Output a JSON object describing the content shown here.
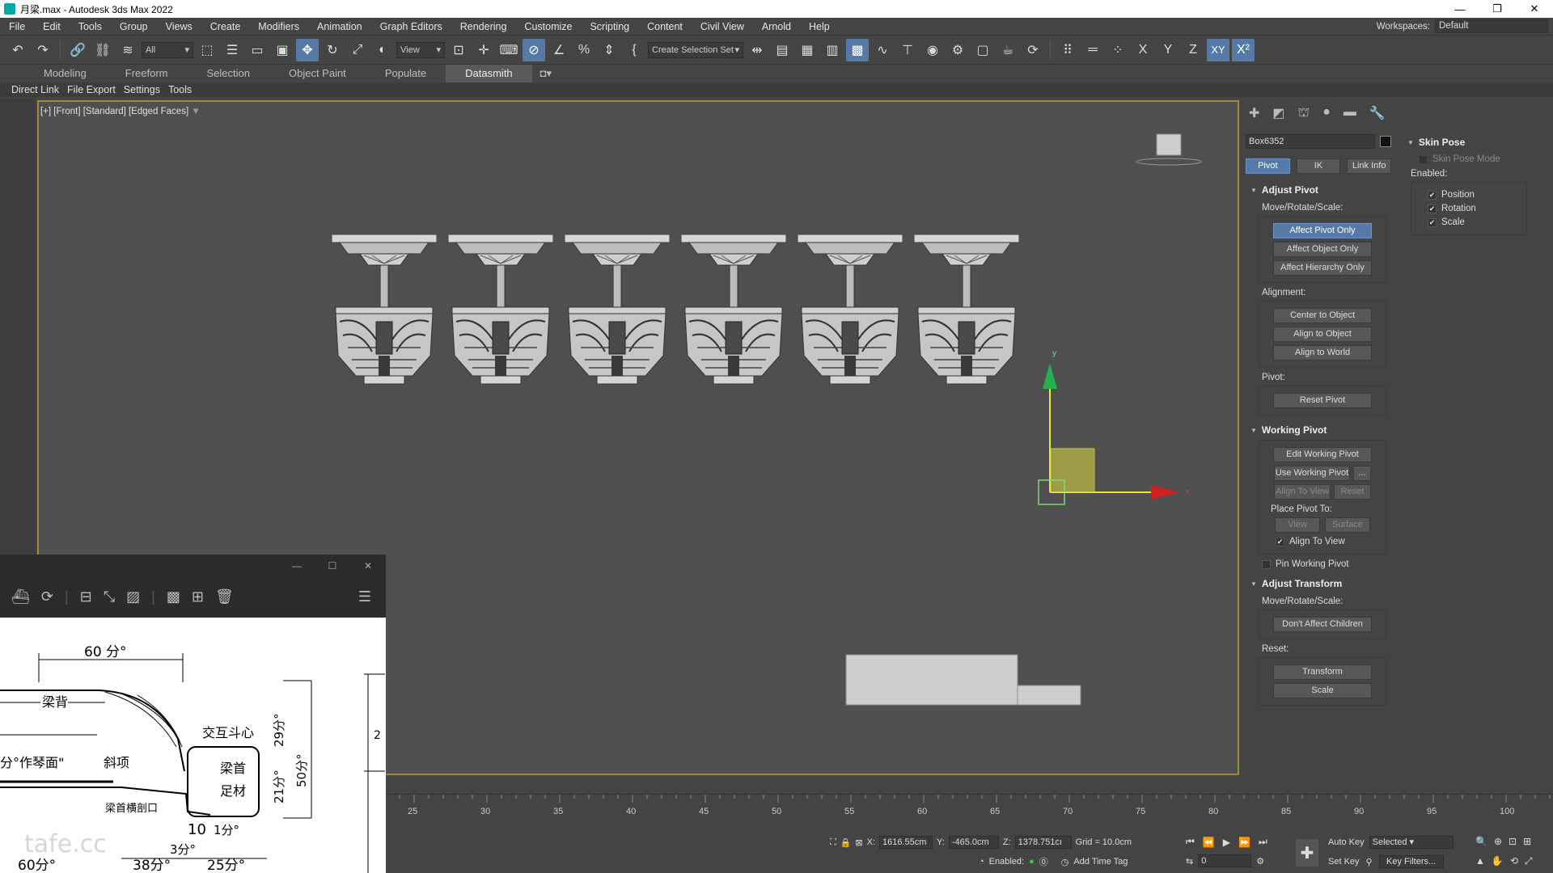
{
  "window": {
    "title": "月梁.max - Autodesk 3ds Max 2022"
  },
  "menu": [
    "File",
    "Edit",
    "Tools",
    "Group",
    "Views",
    "Create",
    "Modifiers",
    "Animation",
    "Graph Editors",
    "Rendering",
    "Customize",
    "Scripting",
    "Content",
    "Civil View",
    "Arnold",
    "Help"
  ],
  "workspace": {
    "label": "Workspaces:",
    "value": "Default"
  },
  "toolbar": {
    "selection_filter": "All",
    "coord_system": "View",
    "named_selection": "Create Selection Set",
    "axis_x": "X",
    "axis_y": "Y",
    "axis_z": "Z",
    "axis_xy": "XY"
  },
  "ribbon_tabs": [
    "Modeling",
    "Freeform",
    "Selection",
    "Object Paint",
    "Populate",
    "Datasmith"
  ],
  "subbar": [
    "Direct Link",
    "File Export",
    "Settings",
    "Tools"
  ],
  "viewport": {
    "label": "[+] [Front] [Standard] [Edged Faces]",
    "gizmo_y": "y",
    "gizmo_x": "x"
  },
  "command_panel": {
    "object_name": "Box6352",
    "tabs": [
      "Pivot",
      "IK",
      "Link Info"
    ],
    "adjust_pivot": {
      "title": "Adjust Pivot",
      "move_label": "Move/Rotate/Scale:",
      "buttons": [
        "Affect Pivot Only",
        "Affect Object Only",
        "Affect Hierarchy Only"
      ],
      "alignment_label": "Alignment:",
      "alignment_buttons": [
        "Center to Object",
        "Align to Object",
        "Align to World"
      ],
      "pivot_label": "Pivot:",
      "reset_pivot": "Reset Pivot"
    },
    "working_pivot": {
      "title": "Working Pivot",
      "edit": "Edit Working Pivot",
      "use": "Use Working Pivot",
      "use_more": "...",
      "align_to_view": "Align To View",
      "reset": "Reset",
      "place_label": "Place Pivot To:",
      "view": "View",
      "surface": "Surface",
      "chk_align": "Align To View",
      "chk_pin": "Pin Working Pivot"
    },
    "adjust_transform": {
      "title": "Adjust Transform",
      "move_label": "Move/Rotate/Scale:",
      "dont_affect": "Don't Affect Children",
      "reset_label": "Reset:",
      "transform": "Transform",
      "scale": "Scale"
    },
    "skin_pose": {
      "title": "Skin Pose",
      "mode": "Skin Pose Mode",
      "enabled_label": "Enabled:",
      "position": "Position",
      "rotation": "Rotation",
      "scale": "Scale"
    }
  },
  "timeline": {
    "ticks": [
      "25",
      "30",
      "35",
      "40",
      "45",
      "50",
      "55",
      "60",
      "65",
      "70",
      "75",
      "80",
      "85",
      "90",
      "95",
      "100"
    ]
  },
  "status": {
    "x_label": "X:",
    "x": "1616.55cm",
    "y_label": "Y:",
    "y": "-465.0cm",
    "z_label": "Z:",
    "z": "1378.751cı",
    "grid": "Grid = 10.0cm",
    "enabled": "Enabled:",
    "add_time_tag": "Add Time Tag",
    "auto_key": "Auto Key",
    "selected": "Selected",
    "set_key": "Set Key",
    "key_filters": "Key Filters...",
    "frame": "0"
  },
  "ref_image": {
    "dim_60_top": "60 分°",
    "lbl_liangbei": "梁背",
    "lbl_jiaohu": "交互斗心",
    "lbl_zuomian": "分°作琴面\"",
    "lbl_xiexiang": "斜项",
    "lbl_liangshou": "梁首",
    "lbl_zuomu": "足材",
    "lbl_sha": "梁首横剖口",
    "dim_29": "29分°",
    "dim_21": "21分°",
    "dim_50": "50分°",
    "dim_10": "10",
    "dim_1": "1分°",
    "dim_3": "3分°",
    "dim_38": "38分°",
    "dim_25": "25分°",
    "dim_60_bottom": "60分°",
    "dim_2": "2",
    "watermark": "tafe.cc"
  }
}
